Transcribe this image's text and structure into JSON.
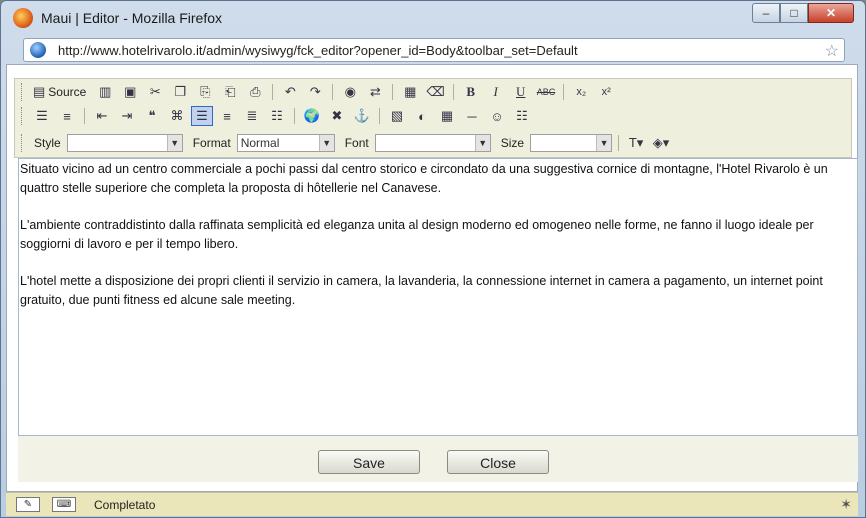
{
  "window": {
    "title": "Maui | Editor - Mozilla Firefox",
    "min_icon": "minimize-icon",
    "max_icon": "maximize-icon",
    "close_icon": "close-icon"
  },
  "urlbar": {
    "url": "http://www.hotelrivarolo.it/admin/wysiwyg/fck_editor?opener_id=Body&toolbar_set=Default"
  },
  "toolbar": {
    "source_label": "Source",
    "style_label": "Style",
    "style_value": "",
    "format_label": "Format",
    "format_value": "Normal",
    "font_label": "Font",
    "font_value": "",
    "size_label": "Size",
    "size_value": ""
  },
  "editor": {
    "paragraphs": [
      "Situato vicino ad un centro commerciale a pochi passi dal centro storico e circondato da una suggestiva cornice di montagne, l'Hotel Rivarolo è un quattro stelle superiore che completa la proposta di hôtellerie nel Canavese.",
      "L'ambiente contraddistinto dalla raffinata semplicità ed eleganza unita al design moderno ed omogeneo nelle forme, ne fanno il luogo ideale per soggiorni di lavoro e per il tempo libero.",
      "L'hotel mette a disposizione dei propri clienti il servizio in camera, la lavanderia, la connessione internet in camera a pagamento, un internet point gratuito, due punti fitness ed alcune sale meeting."
    ]
  },
  "buttons": {
    "save": "Save",
    "close": "Close"
  },
  "statusbar": {
    "text": "Completato"
  }
}
